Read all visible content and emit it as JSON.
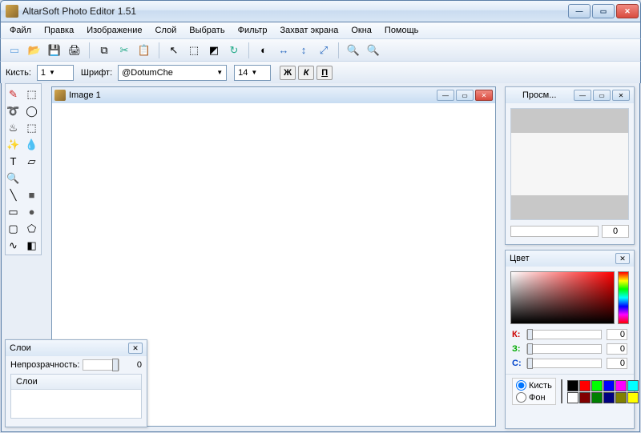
{
  "app": {
    "title": "AltarSoft Photo Editor 1.51"
  },
  "menu": [
    "Файл",
    "Правка",
    "Изображение",
    "Слой",
    "Выбрать",
    "Фильтр",
    "Захват экрана",
    "Окна",
    "Помощь"
  ],
  "toolbar2": {
    "brush_label": "Кисть:",
    "brush_size": "1",
    "font_label": "Шрифт:",
    "font_name": "@DotumChe",
    "font_size": "14",
    "bold": "Ж",
    "italic": "К",
    "underline": "П"
  },
  "document": {
    "title": "Image 1"
  },
  "layers": {
    "title": "Слои",
    "opacity_label": "Непрозрачность:",
    "opacity_value": "0",
    "list_header": "Слои"
  },
  "preview": {
    "title": "Просм...",
    "zoom_value": "0"
  },
  "color": {
    "title": "Цвет",
    "r_label": "К:",
    "g_label": "З:",
    "b_label": "С:",
    "r_val": "0",
    "g_val": "0",
    "b_val": "0",
    "brush_radio": "Кисть",
    "bg_radio": "Фон",
    "palette": [
      "#000000",
      "#ff0000",
      "#00ff00",
      "#0000ff",
      "#ff00ff",
      "#00ffff",
      "#ffffff",
      "#800000",
      "#008000",
      "#000080",
      "#808000",
      "#ffff00"
    ]
  }
}
